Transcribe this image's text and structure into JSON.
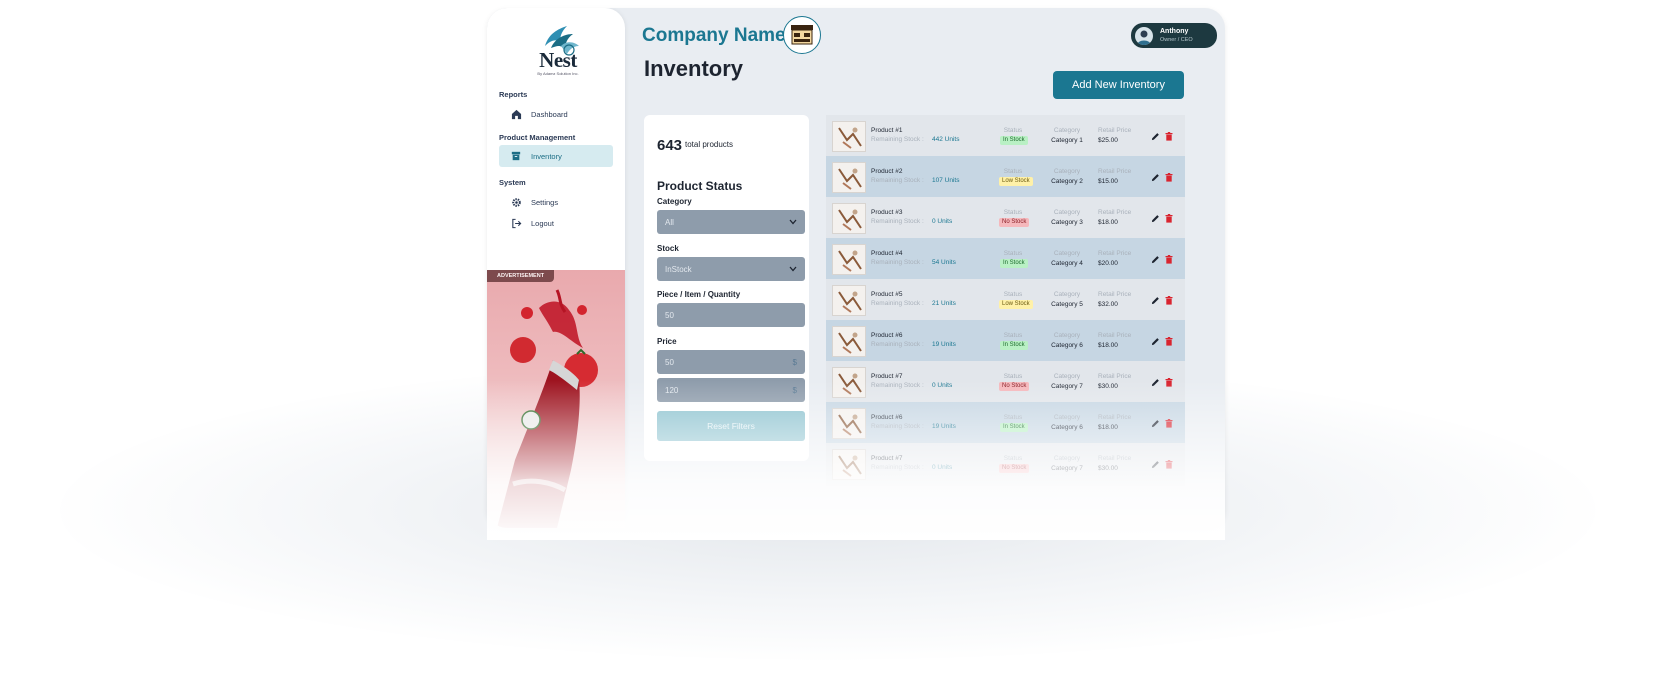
{
  "brand": {
    "logo_text": "Nest",
    "logo_sub": "By Adamz Solution Inc."
  },
  "sidebar": {
    "sections": [
      {
        "heading": "Reports",
        "items": [
          {
            "label": "Dashboard",
            "icon": "home-icon",
            "active": false
          }
        ]
      },
      {
        "heading": "Product Management",
        "items": [
          {
            "label": "Inventory",
            "icon": "box-icon",
            "active": true
          }
        ]
      },
      {
        "heading": "System",
        "items": [
          {
            "label": "Settings",
            "icon": "gear-icon",
            "active": false
          },
          {
            "label": "Logout",
            "icon": "logout-icon",
            "active": false
          }
        ]
      }
    ],
    "ad_label": "ADVERTISEMENT"
  },
  "header": {
    "company": "Company Name",
    "page_title": "Inventory",
    "add_button": "Add New Inventory"
  },
  "user": {
    "name": "Anthony",
    "role": "Owner / CEO"
  },
  "filters": {
    "total_count": "643",
    "total_label": "total products",
    "title": "Product Status",
    "category_label": "Category",
    "category_value": "All",
    "stock_label": "Stock",
    "stock_value": "InStock",
    "quantity_label": "Piece / Item / Quantity",
    "quantity_value": "50",
    "price_label": "Price",
    "price_min": "50",
    "price_max": "120",
    "currency": "$",
    "reset_label": "Reset Filters"
  },
  "table": {
    "labels": {
      "remaining": "Remaining Stock :",
      "status": "Status",
      "category": "Category",
      "price": "Retail Price"
    },
    "rows": [
      {
        "name": "Product #1",
        "stock": "442 Units",
        "status": "In Stock",
        "status_kind": "in",
        "category": "Category 1",
        "price": "$25.00"
      },
      {
        "name": "Product #2",
        "stock": "107 Units",
        "status": "Low Stock",
        "status_kind": "low",
        "category": "Category 2",
        "price": "$15.00"
      },
      {
        "name": "Product #3",
        "stock": "0 Units",
        "status": "No Stock",
        "status_kind": "no",
        "category": "Category 3",
        "price": "$18.00"
      },
      {
        "name": "Product #4",
        "stock": "54 Units",
        "status": "In Stock",
        "status_kind": "in",
        "category": "Category 4",
        "price": "$20.00"
      },
      {
        "name": "Product #5",
        "stock": "21 Units",
        "status": "Low Stock",
        "status_kind": "low",
        "category": "Category 5",
        "price": "$32.00"
      },
      {
        "name": "Product #6",
        "stock": "19 Units",
        "status": "In Stock",
        "status_kind": "in",
        "category": "Category 6",
        "price": "$18.00"
      },
      {
        "name": "Product #7",
        "stock": "0 Units",
        "status": "No Stock",
        "status_kind": "no",
        "category": "Category 7",
        "price": "$30.00"
      },
      {
        "name": "Product #6",
        "stock": "19 Units",
        "status": "In Stock",
        "status_kind": "in",
        "category": "Category 6",
        "price": "$18.00"
      },
      {
        "name": "Product #7",
        "stock": "0 Units",
        "status": "No Stock",
        "status_kind": "no",
        "category": "Category 7",
        "price": "$30.00"
      }
    ]
  },
  "colors": {
    "accent": "#1b7791",
    "in_stock": "#b9f0c4",
    "low_stock": "#fff1a8",
    "no_stock": "#f5b8bc",
    "delete": "#d9242f"
  }
}
